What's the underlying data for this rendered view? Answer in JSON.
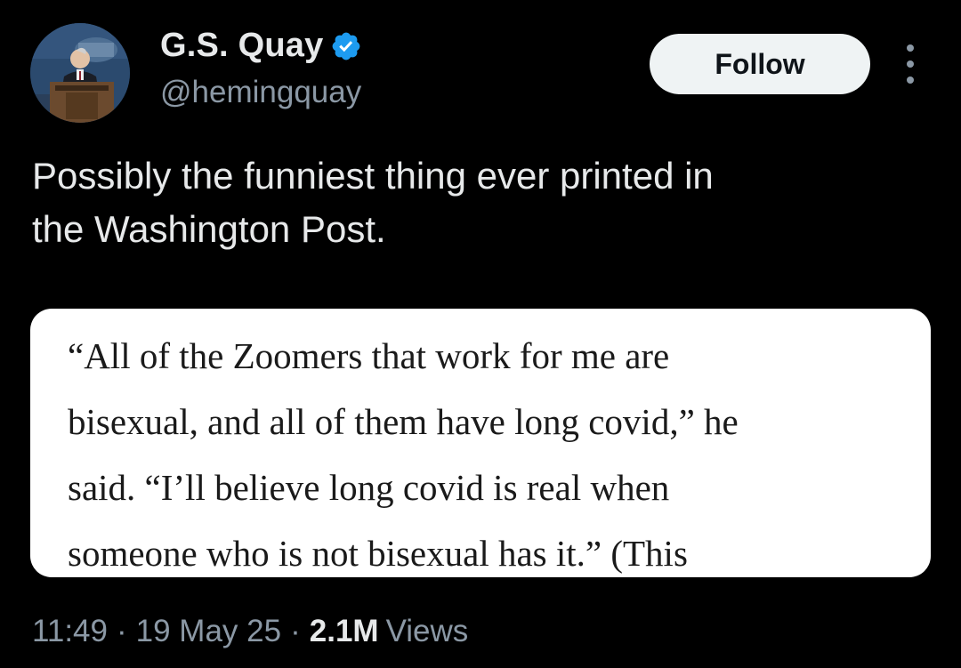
{
  "author": {
    "display_name": "G.S. Quay",
    "handle": "@hemingquay",
    "verified_icon": "verified-badge-icon",
    "avatar_icon": "avatar-podium-photo"
  },
  "actions": {
    "follow_label": "Follow",
    "more_icon": "more-options-icon"
  },
  "tweet": {
    "text": "Possibly the funniest thing ever printed in\nthe Washington Post."
  },
  "media": {
    "quote_text": "“All of the Zoomers that work for me are\nbisexual, and all of them have long covid,” he\nsaid. “I’ll believe long covid is real when\nsomeone who is not bisexual has it.” (This"
  },
  "meta": {
    "time": "11:49",
    "separator_1": "·",
    "date": "19 May 25",
    "separator_2": "·",
    "views_count": "2.1M",
    "views_label": "Views"
  },
  "colors": {
    "background": "#000000",
    "primary_text": "#e7e9ea",
    "secondary_text": "#8b98a5",
    "verified_blue": "#1d9bf0",
    "follow_button_bg": "#eff3f4"
  }
}
